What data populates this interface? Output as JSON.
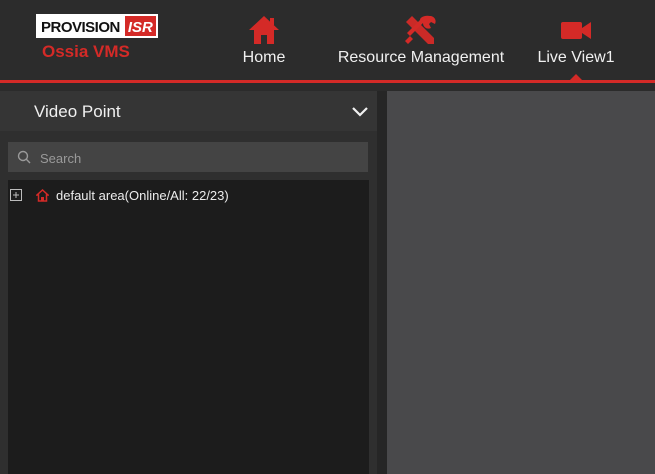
{
  "brand": {
    "logo_text": "PROVISION",
    "logo_badge": "ISR",
    "product_name": "Ossia VMS"
  },
  "nav": {
    "items": [
      {
        "label": "Home",
        "icon": "home-icon"
      },
      {
        "label": "Resource Management",
        "icon": "tools-icon"
      },
      {
        "label": "Live View1",
        "icon": "video-camera-icon",
        "active": true
      }
    ]
  },
  "left_panel": {
    "title": "Video Point",
    "search_placeholder": "Search",
    "tree": [
      {
        "label": "default area(Online/All: 22/23)",
        "icon": "area-house-icon",
        "expand_icon": "plus-square-icon"
      }
    ]
  },
  "colors": {
    "accent": "#d42a27",
    "topbar_bg": "#2c2c2c",
    "video_area_bg": "#49494b",
    "tree_bg": "#1c1c1c"
  }
}
